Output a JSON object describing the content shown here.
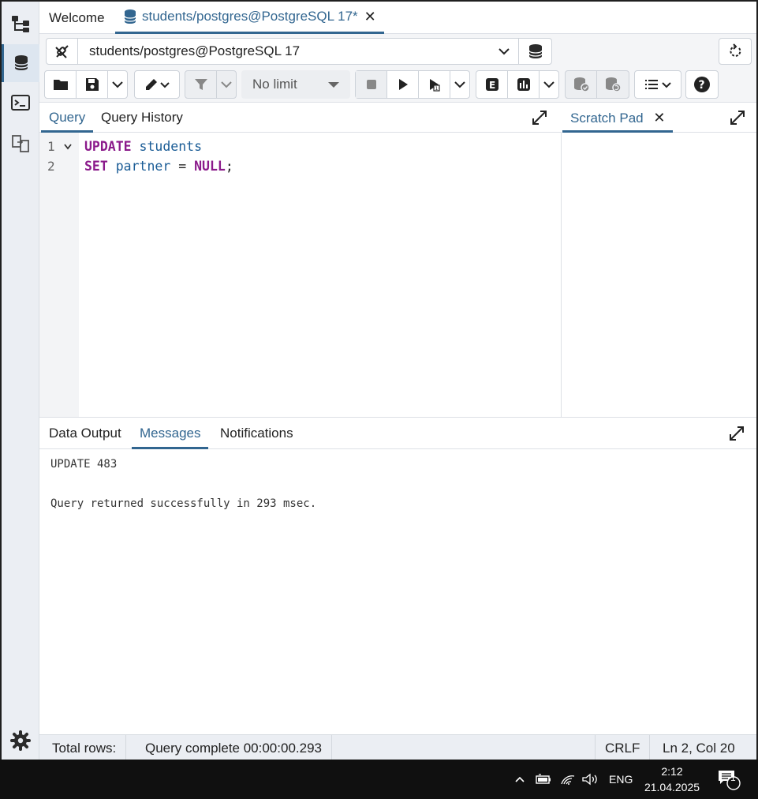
{
  "window_tabs": {
    "welcome": "Welcome",
    "active_query_tab": "students/postgres@PostgreSQL 17*",
    "close_glyph": "✕"
  },
  "connection": {
    "label": "students/postgres@PostgreSQL 17"
  },
  "toolbar": {
    "row_limit": "No limit"
  },
  "editor": {
    "tabs": [
      "Query",
      "Query History"
    ],
    "active_tab": "Query",
    "lines": [
      {
        "number": "1",
        "tokens": [
          {
            "t": "UPDATE",
            "k": "kw"
          },
          {
            "t": " ",
            "k": "pl"
          },
          {
            "t": "students",
            "k": "id"
          }
        ]
      },
      {
        "number": "2",
        "tokens": [
          {
            "t": "SET",
            "k": "kw"
          },
          {
            "t": " ",
            "k": "pl"
          },
          {
            "t": "partner",
            "k": "id"
          },
          {
            "t": " = ",
            "k": "pl"
          },
          {
            "t": "NULL",
            "k": "kw"
          },
          {
            "t": ";",
            "k": "pl"
          }
        ]
      }
    ]
  },
  "scratch_pad": {
    "tab_label": "Scratch Pad"
  },
  "results": {
    "tabs": [
      "Data Output",
      "Messages",
      "Notifications"
    ],
    "active_tab": "Messages",
    "messages": [
      "UPDATE 483",
      "Query returned successfully in 293 msec."
    ]
  },
  "status_bar": {
    "total_rows": "Total rows:",
    "query_status": "Query complete 00:00:00.293",
    "line_ending": "CRLF",
    "cursor_position": "Ln 2, Col 20"
  },
  "taskbar": {
    "language": "ENG",
    "time": "2:12",
    "date": "21.04.2025",
    "notification_count": "1"
  },
  "colors": {
    "accent": "#326690",
    "keyword": "#8b1a8b",
    "identifier": "#1a5c96"
  }
}
